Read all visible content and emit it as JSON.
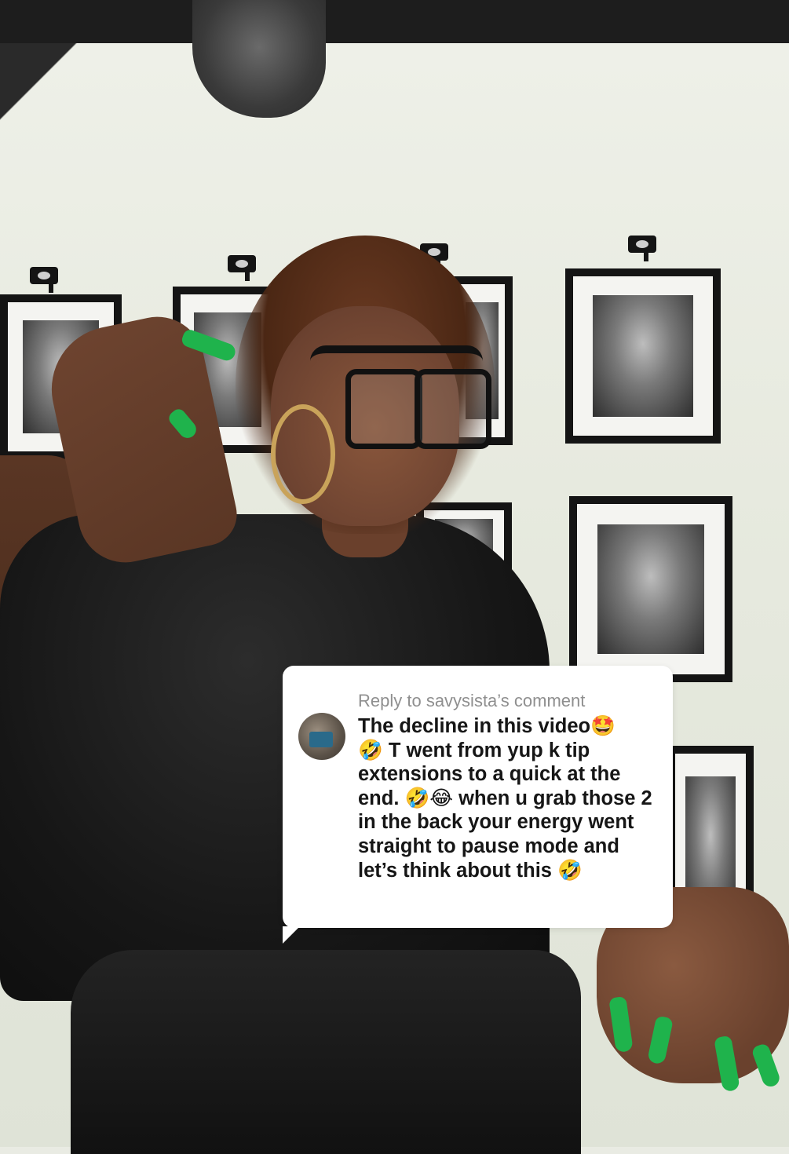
{
  "reply": {
    "header": "Reply to savysista’s comment",
    "text": "The decline in this video🤩\n🤣 T went from yup k tip extensions to a quick at the end. 🤣😂 when u grab those 2 in the back your energy went straight to pause mode and let’s think about this 🤣",
    "avatar_icon": "user-avatar"
  },
  "scene": {
    "description_colors": {
      "wall": "#e9ebe3",
      "shirt": "#161616",
      "nails": "#1fb34c",
      "bubble": "#ffffff",
      "header_text": "#8f8f8f",
      "comment_text": "#161616"
    }
  }
}
